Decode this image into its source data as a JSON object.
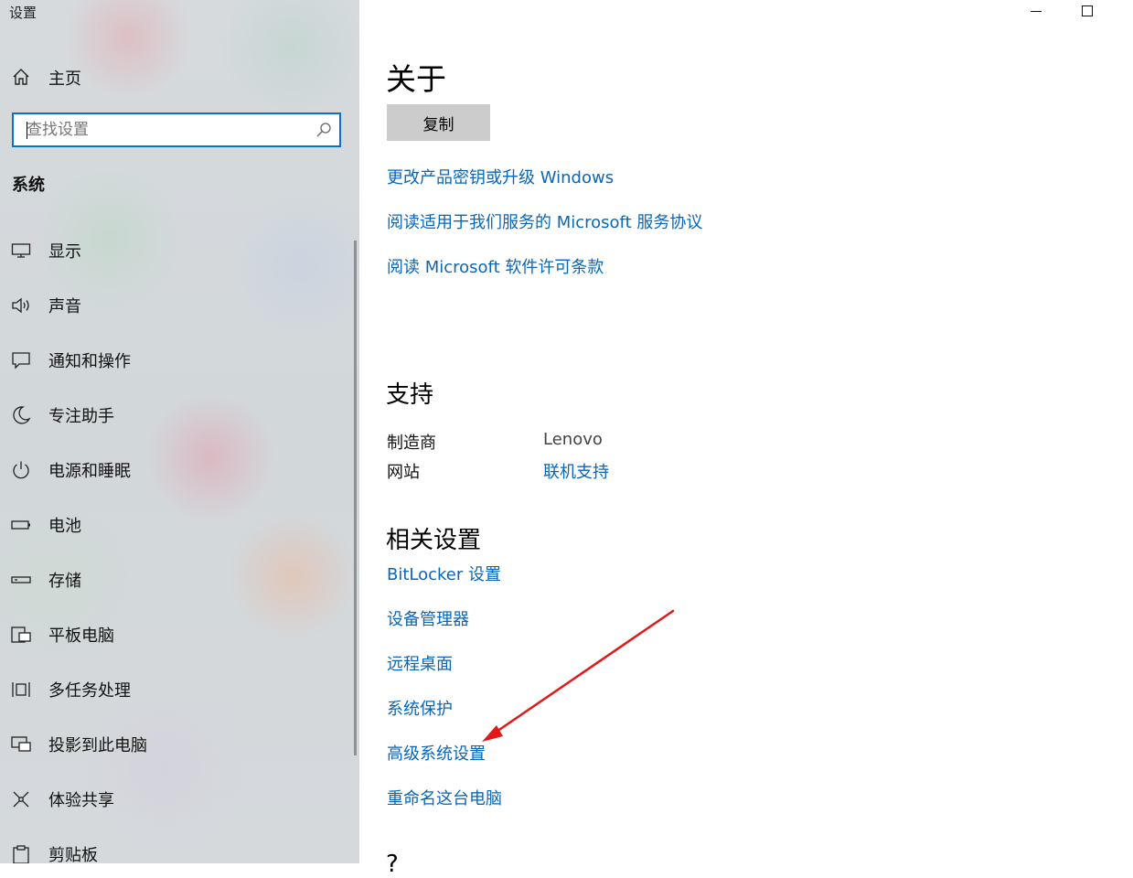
{
  "window": {
    "title": "设置",
    "minimize_icon": "minimize-icon",
    "maximize_icon": "maximize-icon"
  },
  "nav": {
    "home_label": "主页",
    "home_icon": "home-icon",
    "search": {
      "placeholder": "查找设置",
      "icon": "search-icon"
    },
    "section_title": "系统",
    "items": [
      {
        "label": "显示",
        "icon": "display-icon"
      },
      {
        "label": "声音",
        "icon": "speaker-icon"
      },
      {
        "label": "通知和操作",
        "icon": "notification-icon"
      },
      {
        "label": "专注助手",
        "icon": "moon-icon"
      },
      {
        "label": "电源和睡眠",
        "icon": "power-icon"
      },
      {
        "label": "电池",
        "icon": "battery-icon"
      },
      {
        "label": "存储",
        "icon": "storage-icon"
      },
      {
        "label": "平板电脑",
        "icon": "tablet-icon"
      },
      {
        "label": "多任务处理",
        "icon": "multitask-icon"
      },
      {
        "label": "投影到此电脑",
        "icon": "project-icon"
      },
      {
        "label": "体验共享",
        "icon": "share-icon"
      },
      {
        "label": "剪贴板",
        "icon": "clipboard-icon"
      }
    ]
  },
  "main": {
    "title": "关于",
    "copy_button": "复制",
    "links": [
      "更改产品密钥或升级 Windows",
      "阅读适用于我们服务的 Microsoft 服务协议",
      "阅读 Microsoft 软件许可条款"
    ],
    "support": {
      "title": "支持",
      "manufacturer_label": "制造商",
      "manufacturer_value": "Lenovo",
      "website_label": "网站",
      "website_link": "联机支持"
    },
    "related": {
      "title": "相关设置",
      "links": [
        "BitLocker 设置",
        "设备管理器",
        "远程桌面",
        "系统保护",
        "高级系统设置",
        "重命名这台电脑"
      ]
    },
    "cut_off_heading": "?"
  },
  "annotation": {
    "arrow_color": "#e0191b"
  }
}
